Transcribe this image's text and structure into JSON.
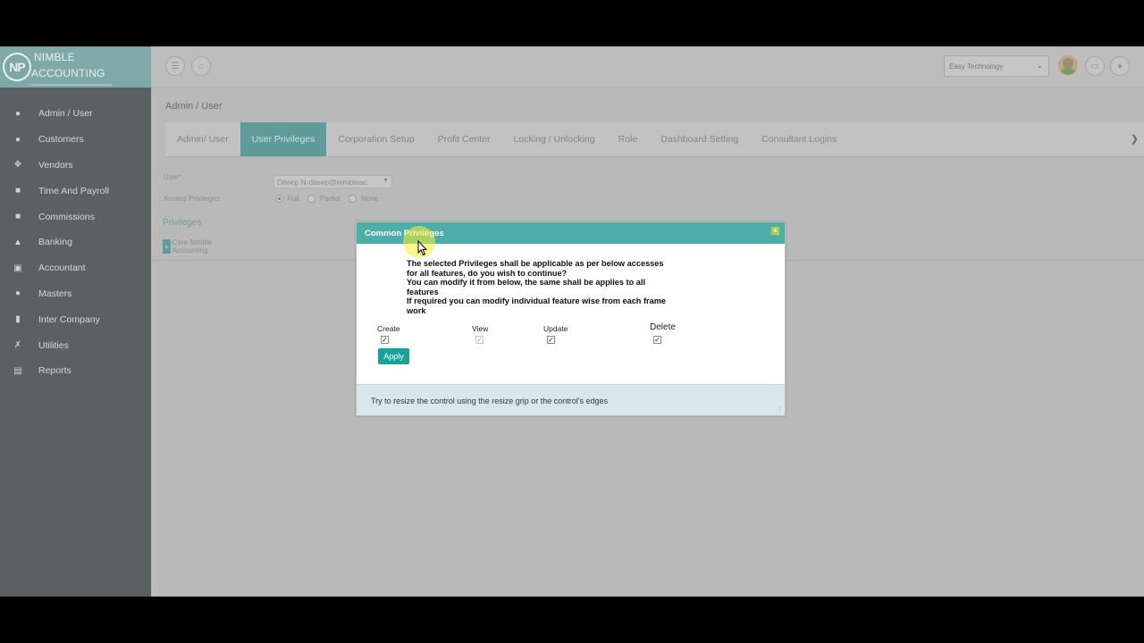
{
  "brand": {
    "logo_mark": "NP",
    "name": "NIMBLE ACCOUNTING"
  },
  "sidebar": {
    "items": [
      {
        "label": "Admin / User",
        "icon": "user-icon"
      },
      {
        "label": "Customers",
        "icon": "users-icon"
      },
      {
        "label": "Vendors",
        "icon": "handshake-icon"
      },
      {
        "label": "Time And Payroll",
        "icon": "clipboard-icon"
      },
      {
        "label": "Commissions",
        "icon": "briefcase-icon"
      },
      {
        "label": "Banking",
        "icon": "bank-icon"
      },
      {
        "label": "Accountant",
        "icon": "id-card-icon"
      },
      {
        "label": "Masters",
        "icon": "person-icon"
      },
      {
        "label": "Inter Company",
        "icon": "building-icon"
      },
      {
        "label": "Utilities",
        "icon": "wrench-icon"
      },
      {
        "label": "Reports",
        "icon": "report-icon"
      }
    ]
  },
  "topbar": {
    "company_select": "Easy Technology"
  },
  "breadcrumb": "Admin / User",
  "tabs": [
    {
      "label": "Admin/ User"
    },
    {
      "label": "User Privileges"
    },
    {
      "label": "Corporation Setup"
    },
    {
      "label": "Profit Center"
    },
    {
      "label": "Locking / Unlocking"
    },
    {
      "label": "Role"
    },
    {
      "label": "Dashboard Setting"
    },
    {
      "label": "Consultant Logins"
    }
  ],
  "form": {
    "user_label": "User*",
    "user_value": "Dileep N-dileep@nimbleac",
    "access_label": "Access Privileges",
    "access_options": {
      "full": "Full",
      "partial": "Partial",
      "none": "None"
    },
    "selected_access": "Full",
    "privileges_title": "Privileges",
    "core_label": "Core Nimble Accounting",
    "core_toggle": "+"
  },
  "dialog": {
    "title": "Common Privileges",
    "close_label": "x",
    "message_lines": [
      "The selected Privileges shall be applicable as per below accesses",
      "for all features, do you wish to continue?",
      "You can modify it from below, the same shall be applies to all",
      "features",
      "If required you can modify individual feature wise from each frame",
      "work"
    ],
    "permissions": {
      "create": {
        "label": "Create",
        "checked": true
      },
      "view": {
        "label": "View",
        "checked": true
      },
      "update": {
        "label": "Update",
        "checked": true
      },
      "delete": {
        "label": "Delete",
        "checked": true
      }
    },
    "apply_label": "Apply",
    "footer": "Try to resize the control using the resize grip or the control's edges"
  },
  "colors": {
    "accent": "#4eada8",
    "apply_button": "#17a29a",
    "sidebar_bg": "#5b6063",
    "active_tab": "#5e9c99"
  }
}
